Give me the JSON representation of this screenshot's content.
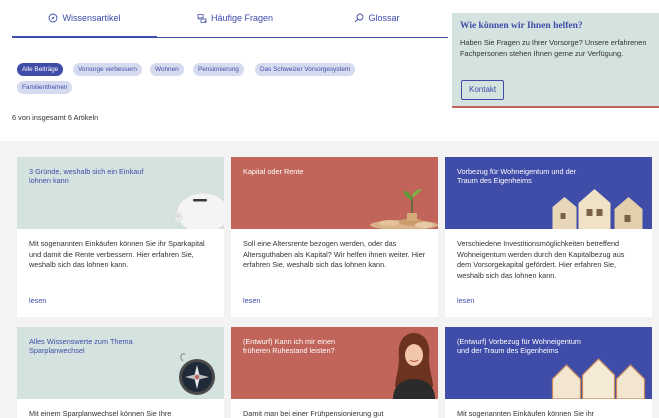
{
  "tabs": [
    {
      "label": "Wissensartikel",
      "icon": "compass-icon",
      "active": true
    },
    {
      "label": "Häufige Fragen",
      "icon": "chat-bubbles-icon",
      "active": false
    },
    {
      "label": "Glossar",
      "icon": "magnifier-icon",
      "active": false
    }
  ],
  "help": {
    "title": "Wie können wir Ihnen helfen?",
    "text": "Haben Sie Fragen zu Ihrer Vorsorge? Unsere erfahrenen Fachpersonen stehen Ihnen gerne zur Verfügung.",
    "button": "Kontakt"
  },
  "filters": [
    {
      "label": "Alle Beiträge",
      "active": true
    },
    {
      "label": "Vorsorge verbessern",
      "active": false
    },
    {
      "label": "Wohnen",
      "active": false
    },
    {
      "label": "Pensionierung",
      "active": false
    },
    {
      "label": "Das Schweizer Vorsorgesystem",
      "active": false
    },
    {
      "label": "Familienthemen",
      "active": false
    }
  ],
  "count_text": "6 von insgesamt 6 Artikeln",
  "cards": [
    {
      "title": "3 Gründe, weshalb sich ein Einkauf lohnen kann",
      "text": "Mit sogenannten Einkäufen können Sie ihr Sparkapital und damit die Rente verbessern. Hier erfahren Sie, weshalb sich das lohnen kann.",
      "link": "lesen",
      "theme": "mint",
      "illustration": "piggy-bank"
    },
    {
      "title": "Kapital oder Rente",
      "text": "Soll eine Altersrente bezogen werden, oder das Altersguthaben als Kapital? Wir helfen ihnen weiter. Hier erfahren Sie, weshalb sich das lohnen kann.",
      "link": "lesen",
      "theme": "red",
      "illustration": "coins-plant"
    },
    {
      "title": "Vorbezug für Wohneigentum und der Traum des Eigenheims",
      "text": "Verschiedene Investitionsmöglichkeiten betreffend Wohneigentum werden durch den Kapitalbezug aus dem Vorsorgekapital gefördert. Hier erfahren Sie, weshalb sich das lohnen kann.",
      "link": "lesen",
      "theme": "blue",
      "illustration": "wooden-houses"
    },
    {
      "title": "Alles Wissenswerte zum Thema Sparplanwechsel",
      "text": "Mit einem Sparplanwechsel können Sie Ihre",
      "link": "",
      "theme": "mint",
      "illustration": "compass"
    },
    {
      "title": "(Entwurf) Kann ich mir einen früheren Ruhestand leisten?",
      "text": "Damit man bei einer Frühpensionierung gut",
      "link": "",
      "theme": "red",
      "illustration": "woman-portrait"
    },
    {
      "title": "(Entwurf) Vorbezug für Wohneigentum und der Traum des Eigenheims",
      "text": "Mit sogenannten Einkäufen können Sie ihr",
      "link": "",
      "theme": "blue",
      "illustration": "wooden-houses"
    }
  ],
  "colors": {
    "primary": "#3f4ca8",
    "mint": "#d4e3df",
    "red": "#c1645a",
    "chip": "#d6dbf0"
  }
}
